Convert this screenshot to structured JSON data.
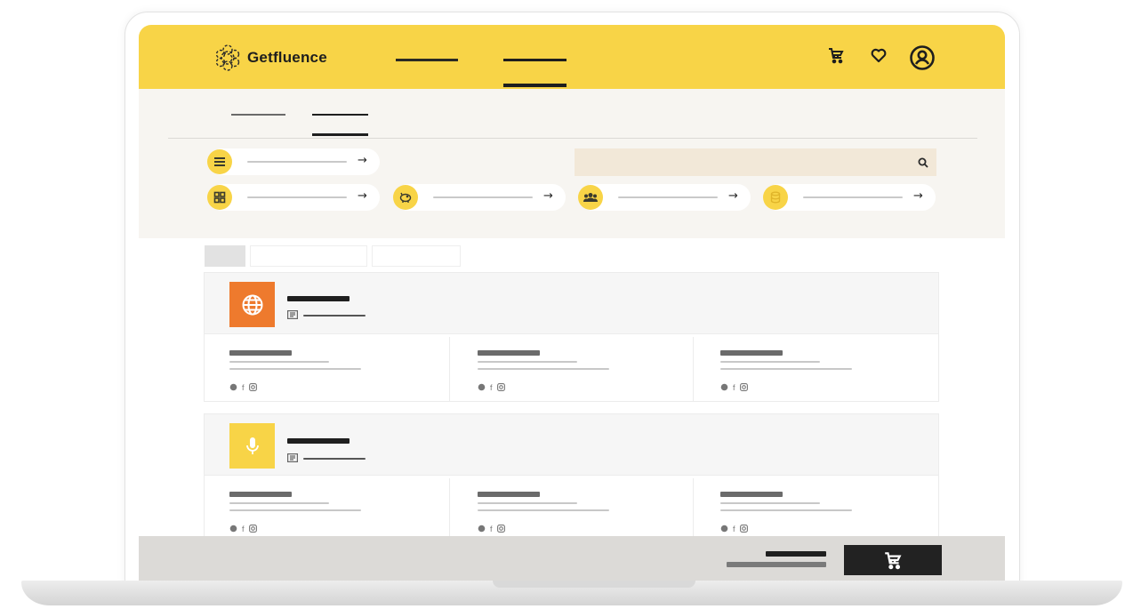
{
  "brand": {
    "name": "Getfluence"
  },
  "header": {
    "icons": [
      "cart-icon",
      "heart-icon",
      "user-icon"
    ]
  },
  "quick_links": {
    "icons": [
      "list-icon",
      "grid-icon",
      "piggy-bank-icon",
      "group-icon",
      "coins-icon"
    ],
    "arrow": "→"
  },
  "search": {
    "icon": "search-icon"
  },
  "cards": [
    {
      "icon": "globe-icon",
      "color": "#ee7a2d"
    },
    {
      "icon": "microphone-icon",
      "color": "#f8d447"
    }
  ],
  "social_icons": [
    "website-icon",
    "facebook-icon",
    "instagram-icon"
  ],
  "footer": {
    "cart_icon": "cart-icon"
  },
  "colors": {
    "brand_yellow": "#f8d447",
    "accent_orange": "#ee7a2d",
    "dark": "#222222"
  }
}
